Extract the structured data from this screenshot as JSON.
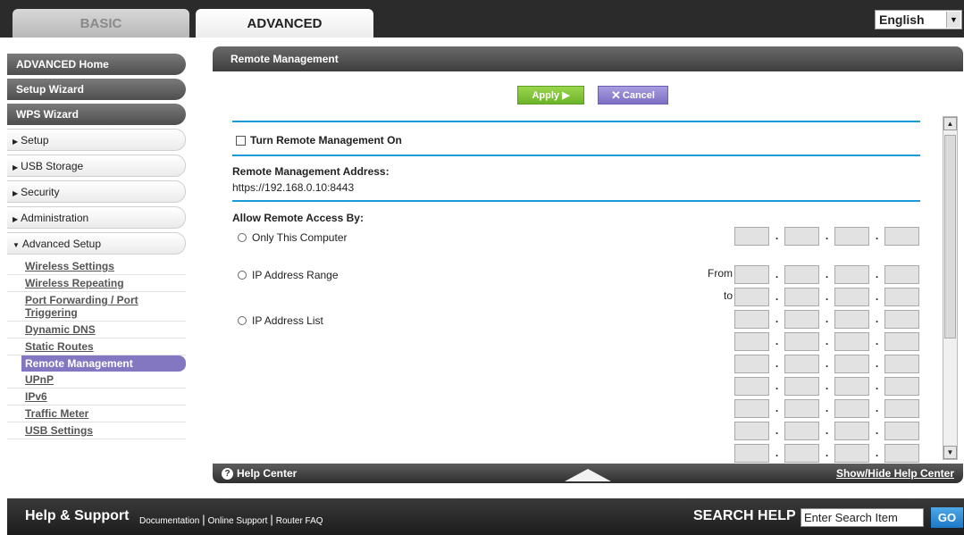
{
  "top_tabs": {
    "basic": "BASIC",
    "advanced": "ADVANCED"
  },
  "language": {
    "selected": "English",
    "arrow": "▼"
  },
  "nav": {
    "dark_items": [
      "ADVANCED Home",
      "Setup Wizard",
      "WPS Wizard"
    ],
    "light_items": [
      {
        "label": "Setup",
        "tri": "▶"
      },
      {
        "label": "USB Storage",
        "tri": "▶"
      },
      {
        "label": "Security",
        "tri": "▶"
      },
      {
        "label": "Administration",
        "tri": "▶"
      },
      {
        "label": "Advanced Setup",
        "tri": "▼"
      }
    ],
    "sub_items": [
      "Wireless Settings",
      "Wireless Repeating",
      "Port Forwarding / Port Triggering",
      "Dynamic DNS",
      "Static Routes",
      "Remote Management",
      "UPnP",
      "IPv6",
      "Traffic Meter",
      "USB Settings"
    ],
    "active_sub": "Remote Management"
  },
  "panel": {
    "title": "Remote Management",
    "apply_label": "Apply ▶",
    "cancel_label": "Cancel",
    "cancel_x": "✕",
    "turn_on_label": "Turn Remote Management On",
    "address_label": "Remote Management Address:",
    "address_value": "https://192.168.0.10:8443",
    "allow_label": "Allow Remote Access By:",
    "options": [
      "Only This Computer",
      "IP Address Range",
      "IP Address List"
    ],
    "from_label": "From",
    "to_label": "to",
    "ip_dot": "."
  },
  "help": {
    "left_label": "Help Center",
    "help_icon": "?",
    "right_label": "Show/Hide Help Center"
  },
  "scrollbar": {
    "up": "▲",
    "down": "▼"
  },
  "support": {
    "title": "Help & Support",
    "links": [
      "Documentation",
      "Online Support",
      "Router FAQ"
    ],
    "separator": "|",
    "search_label": "SEARCH HELP",
    "search_value": "Enter Search Item",
    "go_label": "GO"
  },
  "colors": {
    "accent_blue": "#1a9ad6",
    "apply_green": "#6cb42a",
    "cancel_purple": "#7c6fc4",
    "active_nav": "#8477c2",
    "dark_bar": "#2b2b2b"
  }
}
